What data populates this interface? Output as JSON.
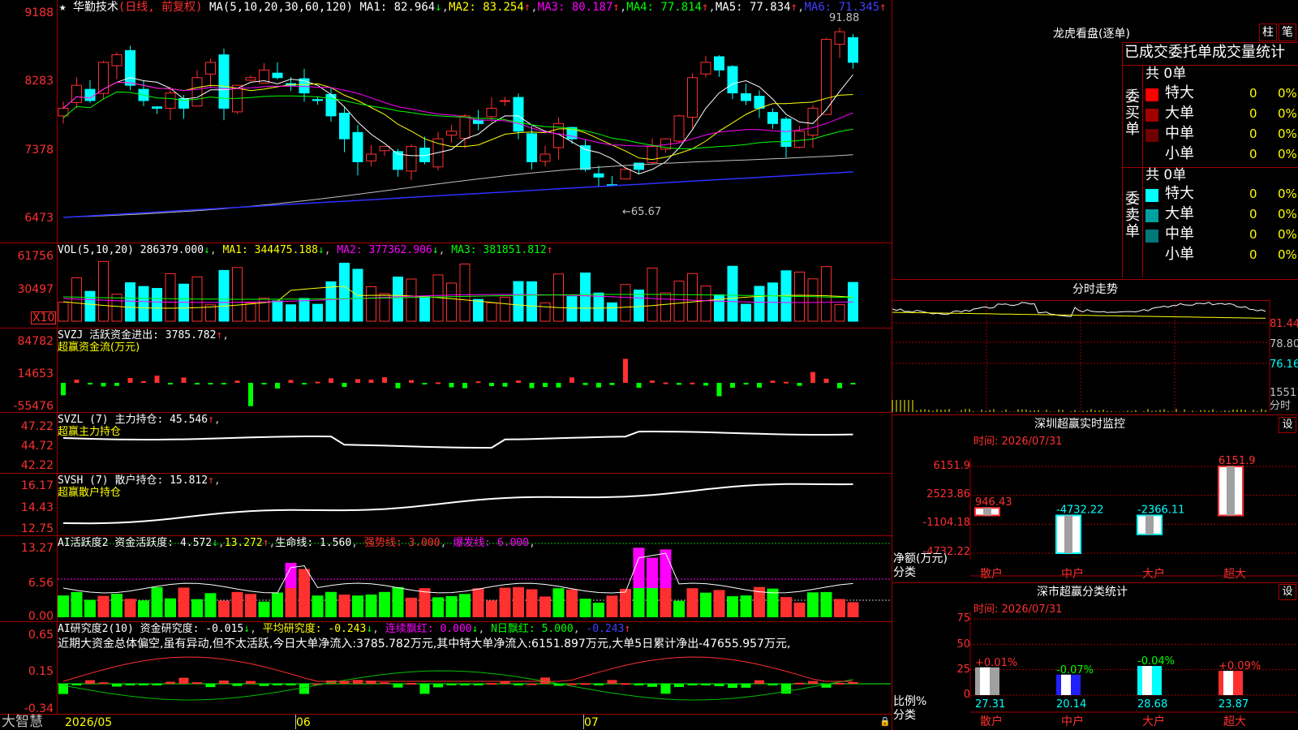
{
  "brand": "大智慧",
  "stock": {
    "name": "华勤技术",
    "period": "(日线, 前复权)"
  },
  "ma_line": {
    "label": "MA(5,10,20,30,60,120)",
    "ma1": "MA1: 82.964",
    "ma2": "MA2: 83.254",
    "ma3": "MA3: 80.187",
    "ma4": "MA4: 77.814",
    "ma5": "MA5: 77.834",
    "ma6": "MA6: 71.345"
  },
  "price": {
    "high_label": "91.88",
    "low_label": "←65.67",
    "ticks": [
      "9188",
      "8283",
      "7378",
      "6473"
    ]
  },
  "vol": {
    "label": "VOL(5,10,20)",
    "v": "286379.000",
    "ma1": "MA1: 344475.188",
    "ma2": "MA2: 377362.906",
    "ma3": "MA3: 381851.812",
    "ticks": [
      "61756",
      "30497"
    ],
    "unit": "X10"
  },
  "svzj": {
    "label": "SVZJ  活跃资金进出: 3785.782",
    "sub": "超赢资金流(万元)",
    "ticks": [
      "84782",
      "14653",
      "-55476"
    ]
  },
  "svzl": {
    "label": "SVZL (7) 主力持仓: 45.546",
    "sub": "超赢主力持仓",
    "ticks": [
      "47.22",
      "44.72",
      "42.22"
    ]
  },
  "svsh": {
    "label": "SVSH (7) 散户持仓: 15.812",
    "sub": "超赢散户持仓",
    "ticks": [
      "16.17",
      "14.43",
      "12.75"
    ]
  },
  "ai1": {
    "label": "AI活跃度2 资金活跃度: 4.572",
    "v2": "13.272",
    "life": "生命线: 1.560",
    "strong": "强势线: 3.000",
    "burst": "爆发线: 6.000",
    "ticks": [
      "13.27",
      "6.56",
      "0.00"
    ]
  },
  "ai2": {
    "label": "AI研究度2(10) 资金研究度: -0.015",
    "avg": "平均研究度: -0.243",
    "red1": "连续飘红: 0.000",
    "red2": "N日飘红: 5.000",
    "last": "-0.243",
    "ticks": [
      "0.65",
      "0.15",
      "-0.34"
    ],
    "comment": "近期大资金总体偏空,虽有异动,但不太活跃,今日大单净流入:3785.782万元,其中特大单净流入:6151.897万元,大单5日累计净出-47655.957万元,"
  },
  "dates": [
    "2026/05",
    "06",
    "07"
  ],
  "dragon": {
    "title": "龙虎看盘(逐单)",
    "btn1": "柱",
    "btn2": "笔",
    "tabs": "已成交委托单成交量统计",
    "buy": {
      "side": "委买单",
      "total": "共 0单",
      "rows": [
        {
          "name": "特大",
          "n": "0",
          "p": "0%",
          "c": "#ff0000"
        },
        {
          "name": "大单",
          "n": "0",
          "p": "0%",
          "c": "#a00000"
        },
        {
          "name": "中单",
          "n": "0",
          "p": "0%",
          "c": "#700000"
        },
        {
          "name": "小单",
          "n": "0",
          "p": "0%",
          "c": ""
        }
      ]
    },
    "sell": {
      "side": "委卖单",
      "total": "共 0单",
      "rows": [
        {
          "name": "特大",
          "n": "0",
          "p": "0%",
          "c": "#00ffff"
        },
        {
          "name": "大单",
          "n": "0",
          "p": "0%",
          "c": "#00a0a0"
        },
        {
          "name": "中单",
          "n": "0",
          "p": "0%",
          "c": "#007878"
        },
        {
          "name": "小单",
          "n": "0",
          "p": "0%",
          "c": ""
        }
      ]
    }
  },
  "intraday": {
    "title": "分时走势",
    "ticks": [
      "81.44",
      "78.80",
      "76.16"
    ],
    "vol": "15511",
    "vol_label": "分时"
  },
  "monitor": {
    "title": "深圳超赢实时监控",
    "btn": "设",
    "time": "时间: 2026/07/31",
    "ticks": [
      "6151.9",
      "2523.86",
      "-1104.18",
      "-4732.22"
    ],
    "unit": "净额(万元)",
    "cat_label": "分类"
  },
  "classify": {
    "title": "深市超赢分类统计",
    "btn": "设",
    "time": "时间: 2026/07/31",
    "ticks": [
      "75",
      "50",
      "25",
      "0"
    ],
    "unit": "比例%",
    "cat_label": "分类"
  },
  "chart_data": [
    {
      "type": "bar",
      "title": "深圳超赢实时监控",
      "ylabel": "净额(万元)",
      "categories": [
        "散户",
        "中户",
        "大户",
        "超大"
      ],
      "values": [
        946.43,
        -4732.22,
        -2366.11,
        6151.9
      ],
      "ylim": [
        -4732.22,
        6151.9
      ]
    },
    {
      "type": "bar",
      "title": "深市超赢分类统计",
      "ylabel": "比例%",
      "categories": [
        "散户",
        "中户",
        "大户",
        "超大"
      ],
      "values": [
        27.31,
        20.14,
        28.68,
        23.87
      ],
      "change": [
        "+0.01%",
        "-0.07%",
        "-0.04%",
        "+0.09%"
      ],
      "ylim": [
        0,
        75
      ]
    }
  ]
}
